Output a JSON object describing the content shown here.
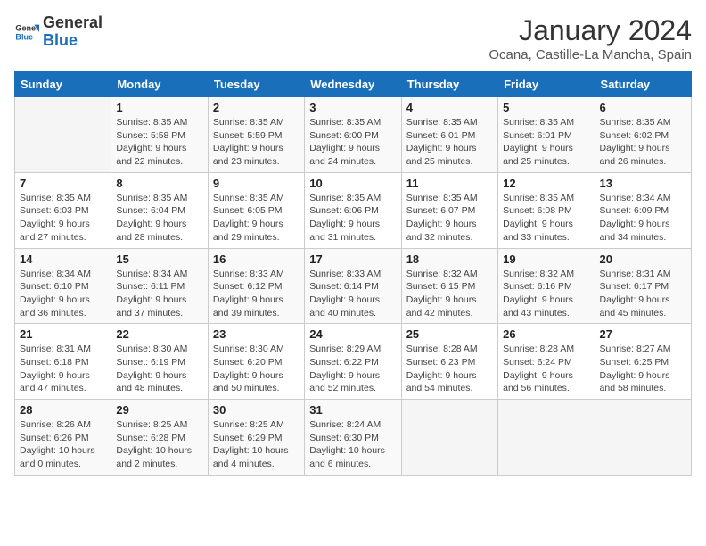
{
  "header": {
    "logo_general": "General",
    "logo_blue": "Blue",
    "month_title": "January 2024",
    "location": "Ocana, Castille-La Mancha, Spain"
  },
  "weekdays": [
    "Sunday",
    "Monday",
    "Tuesday",
    "Wednesday",
    "Thursday",
    "Friday",
    "Saturday"
  ],
  "weeks": [
    [
      {
        "day": "",
        "sunrise": "",
        "sunset": "",
        "daylight": ""
      },
      {
        "day": "1",
        "sunrise": "Sunrise: 8:35 AM",
        "sunset": "Sunset: 5:58 PM",
        "daylight": "Daylight: 9 hours and 22 minutes."
      },
      {
        "day": "2",
        "sunrise": "Sunrise: 8:35 AM",
        "sunset": "Sunset: 5:59 PM",
        "daylight": "Daylight: 9 hours and 23 minutes."
      },
      {
        "day": "3",
        "sunrise": "Sunrise: 8:35 AM",
        "sunset": "Sunset: 6:00 PM",
        "daylight": "Daylight: 9 hours and 24 minutes."
      },
      {
        "day": "4",
        "sunrise": "Sunrise: 8:35 AM",
        "sunset": "Sunset: 6:01 PM",
        "daylight": "Daylight: 9 hours and 25 minutes."
      },
      {
        "day": "5",
        "sunrise": "Sunrise: 8:35 AM",
        "sunset": "Sunset: 6:01 PM",
        "daylight": "Daylight: 9 hours and 25 minutes."
      },
      {
        "day": "6",
        "sunrise": "Sunrise: 8:35 AM",
        "sunset": "Sunset: 6:02 PM",
        "daylight": "Daylight: 9 hours and 26 minutes."
      }
    ],
    [
      {
        "day": "7",
        "sunrise": "Sunrise: 8:35 AM",
        "sunset": "Sunset: 6:03 PM",
        "daylight": "Daylight: 9 hours and 27 minutes."
      },
      {
        "day": "8",
        "sunrise": "Sunrise: 8:35 AM",
        "sunset": "Sunset: 6:04 PM",
        "daylight": "Daylight: 9 hours and 28 minutes."
      },
      {
        "day": "9",
        "sunrise": "Sunrise: 8:35 AM",
        "sunset": "Sunset: 6:05 PM",
        "daylight": "Daylight: 9 hours and 29 minutes."
      },
      {
        "day": "10",
        "sunrise": "Sunrise: 8:35 AM",
        "sunset": "Sunset: 6:06 PM",
        "daylight": "Daylight: 9 hours and 31 minutes."
      },
      {
        "day": "11",
        "sunrise": "Sunrise: 8:35 AM",
        "sunset": "Sunset: 6:07 PM",
        "daylight": "Daylight: 9 hours and 32 minutes."
      },
      {
        "day": "12",
        "sunrise": "Sunrise: 8:35 AM",
        "sunset": "Sunset: 6:08 PM",
        "daylight": "Daylight: 9 hours and 33 minutes."
      },
      {
        "day": "13",
        "sunrise": "Sunrise: 8:34 AM",
        "sunset": "Sunset: 6:09 PM",
        "daylight": "Daylight: 9 hours and 34 minutes."
      }
    ],
    [
      {
        "day": "14",
        "sunrise": "Sunrise: 8:34 AM",
        "sunset": "Sunset: 6:10 PM",
        "daylight": "Daylight: 9 hours and 36 minutes."
      },
      {
        "day": "15",
        "sunrise": "Sunrise: 8:34 AM",
        "sunset": "Sunset: 6:11 PM",
        "daylight": "Daylight: 9 hours and 37 minutes."
      },
      {
        "day": "16",
        "sunrise": "Sunrise: 8:33 AM",
        "sunset": "Sunset: 6:12 PM",
        "daylight": "Daylight: 9 hours and 39 minutes."
      },
      {
        "day": "17",
        "sunrise": "Sunrise: 8:33 AM",
        "sunset": "Sunset: 6:14 PM",
        "daylight": "Daylight: 9 hours and 40 minutes."
      },
      {
        "day": "18",
        "sunrise": "Sunrise: 8:32 AM",
        "sunset": "Sunset: 6:15 PM",
        "daylight": "Daylight: 9 hours and 42 minutes."
      },
      {
        "day": "19",
        "sunrise": "Sunrise: 8:32 AM",
        "sunset": "Sunset: 6:16 PM",
        "daylight": "Daylight: 9 hours and 43 minutes."
      },
      {
        "day": "20",
        "sunrise": "Sunrise: 8:31 AM",
        "sunset": "Sunset: 6:17 PM",
        "daylight": "Daylight: 9 hours and 45 minutes."
      }
    ],
    [
      {
        "day": "21",
        "sunrise": "Sunrise: 8:31 AM",
        "sunset": "Sunset: 6:18 PM",
        "daylight": "Daylight: 9 hours and 47 minutes."
      },
      {
        "day": "22",
        "sunrise": "Sunrise: 8:30 AM",
        "sunset": "Sunset: 6:19 PM",
        "daylight": "Daylight: 9 hours and 48 minutes."
      },
      {
        "day": "23",
        "sunrise": "Sunrise: 8:30 AM",
        "sunset": "Sunset: 6:20 PM",
        "daylight": "Daylight: 9 hours and 50 minutes."
      },
      {
        "day": "24",
        "sunrise": "Sunrise: 8:29 AM",
        "sunset": "Sunset: 6:22 PM",
        "daylight": "Daylight: 9 hours and 52 minutes."
      },
      {
        "day": "25",
        "sunrise": "Sunrise: 8:28 AM",
        "sunset": "Sunset: 6:23 PM",
        "daylight": "Daylight: 9 hours and 54 minutes."
      },
      {
        "day": "26",
        "sunrise": "Sunrise: 8:28 AM",
        "sunset": "Sunset: 6:24 PM",
        "daylight": "Daylight: 9 hours and 56 minutes."
      },
      {
        "day": "27",
        "sunrise": "Sunrise: 8:27 AM",
        "sunset": "Sunset: 6:25 PM",
        "daylight": "Daylight: 9 hours and 58 minutes."
      }
    ],
    [
      {
        "day": "28",
        "sunrise": "Sunrise: 8:26 AM",
        "sunset": "Sunset: 6:26 PM",
        "daylight": "Daylight: 10 hours and 0 minutes."
      },
      {
        "day": "29",
        "sunrise": "Sunrise: 8:25 AM",
        "sunset": "Sunset: 6:28 PM",
        "daylight": "Daylight: 10 hours and 2 minutes."
      },
      {
        "day": "30",
        "sunrise": "Sunrise: 8:25 AM",
        "sunset": "Sunset: 6:29 PM",
        "daylight": "Daylight: 10 hours and 4 minutes."
      },
      {
        "day": "31",
        "sunrise": "Sunrise: 8:24 AM",
        "sunset": "Sunset: 6:30 PM",
        "daylight": "Daylight: 10 hours and 6 minutes."
      },
      {
        "day": "",
        "sunrise": "",
        "sunset": "",
        "daylight": ""
      },
      {
        "day": "",
        "sunrise": "",
        "sunset": "",
        "daylight": ""
      },
      {
        "day": "",
        "sunrise": "",
        "sunset": "",
        "daylight": ""
      }
    ]
  ]
}
